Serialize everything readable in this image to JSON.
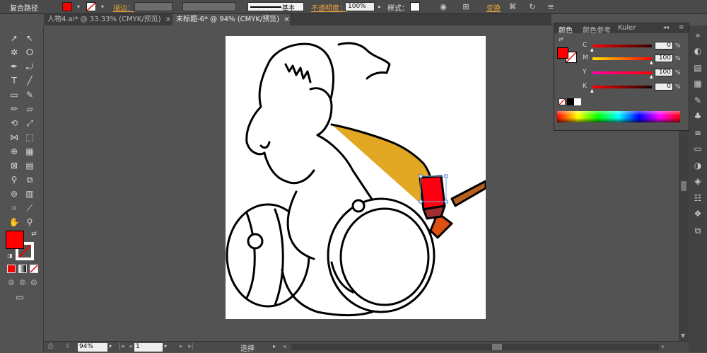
{
  "control_bar": {
    "selection_label": "复合路径",
    "fill_color": "#ff0000",
    "stroke_label": "描边：",
    "brush_label": "基本",
    "opacity_label": "不透明度：",
    "opacity_value": "100%",
    "style_label": "样式：",
    "transform_label": "变换"
  },
  "tabs": [
    {
      "label": "人物4.ai* @ 33.33% (CMYK/预览)",
      "active": false
    },
    {
      "label": "未标题-6* @ 94% (CMYK/预览)",
      "active": true
    }
  ],
  "color_panel": {
    "tabs": [
      "颜色",
      "颜色参考",
      "Kuler"
    ],
    "fill_color": "#ff0000",
    "sliders": [
      {
        "label": "C",
        "value": "0",
        "gradient": "linear-gradient(90deg,#ff0000,#3a0000)"
      },
      {
        "label": "M",
        "value": "100",
        "gradient": "linear-gradient(90deg,#ffe400,#ff0000)"
      },
      {
        "label": "Y",
        "value": "100",
        "gradient": "linear-gradient(90deg,#ff00a8,#ff0000)"
      },
      {
        "label": "K",
        "value": "0",
        "gradient": "linear-gradient(90deg,#ff0000,#200000)"
      }
    ],
    "percent": "%"
  },
  "status_bar": {
    "zoom": "94%",
    "page": "1",
    "tool_status": "选择"
  },
  "toolbox": {
    "fill_color": "#ff0000"
  }
}
